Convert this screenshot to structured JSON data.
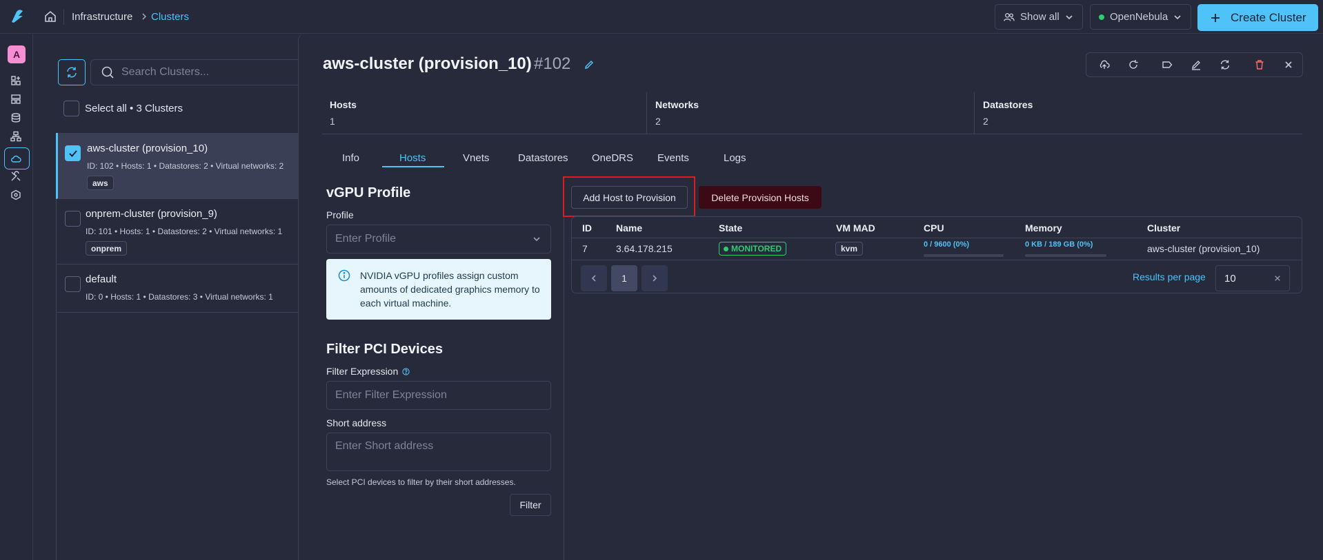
{
  "breadcrumb": {
    "section": "Infrastructure",
    "current": "Clusters"
  },
  "topbar": {
    "show_all_label": "Show all",
    "zone_label": "OpenNebula",
    "create_label": "Create Cluster"
  },
  "user": {
    "avatar_letter": "A"
  },
  "list": {
    "search_placeholder": "Search Clusters...",
    "select_all_label": "Select all • 3 Clusters",
    "clusters": [
      {
        "name": "aws-cluster (provision_10)",
        "meta": "ID: 102 • Hosts: 1 • Datastores: 2 • Virtual networks: 2",
        "tag": "aws",
        "selected": true
      },
      {
        "name": "onprem-cluster (provision_9)",
        "meta": "ID: 101 • Hosts: 1 • Datastores: 2 • Virtual networks: 1",
        "tag": "onprem",
        "selected": false
      },
      {
        "name": "default",
        "meta": "ID: 0 • Hosts: 1 • Datastores: 3 • Virtual networks: 1",
        "tag": "",
        "selected": false
      }
    ]
  },
  "detail": {
    "title": "aws-cluster (provision_10)",
    "id": "#102",
    "stats": [
      {
        "label": "Hosts",
        "value": "1"
      },
      {
        "label": "Networks",
        "value": "2"
      },
      {
        "label": "Datastores",
        "value": "2"
      }
    ],
    "tabs": [
      "Info",
      "Hosts",
      "Vnets",
      "Datastores",
      "OneDRS",
      "Events",
      "Logs"
    ],
    "active_tab": "Hosts"
  },
  "vgpu": {
    "heading": "vGPU Profile",
    "profile_label": "Profile",
    "profile_placeholder": "Enter Profile",
    "info_text": "NVIDIA vGPU profiles assign custom amounts of dedicated graphics memory to each virtual machine."
  },
  "pci": {
    "heading": "Filter PCI Devices",
    "filter_label": "Filter Expression",
    "filter_placeholder": "Enter Filter Expression",
    "short_label": "Short address",
    "short_placeholder": "Enter Short address",
    "hint": "Select PCI devices to filter by their short addresses.",
    "filter_button": "Filter"
  },
  "hosts": {
    "add_button": "Add Host to Provision",
    "delete_button": "Delete Provision Hosts",
    "columns": [
      "ID",
      "Name",
      "State",
      "VM MAD",
      "CPU",
      "Memory",
      "Cluster"
    ],
    "rows": [
      {
        "id": "7",
        "name": "3.64.178.215",
        "state": "MONITORED",
        "vm_mad": "kvm",
        "cpu": "0 / 9600 (0%)",
        "cpu_fraction": 0.0,
        "memory": "0 KB / 189 GB (0%)",
        "memory_fraction": 0.0,
        "cluster": "aws-cluster (provision_10)"
      }
    ],
    "page": "1",
    "results_per_page_label": "Results per page",
    "results_per_page": "10"
  },
  "colors": {
    "accent": "#4fc3f7",
    "danger": "#e01b1b",
    "success": "#2ecc71"
  }
}
